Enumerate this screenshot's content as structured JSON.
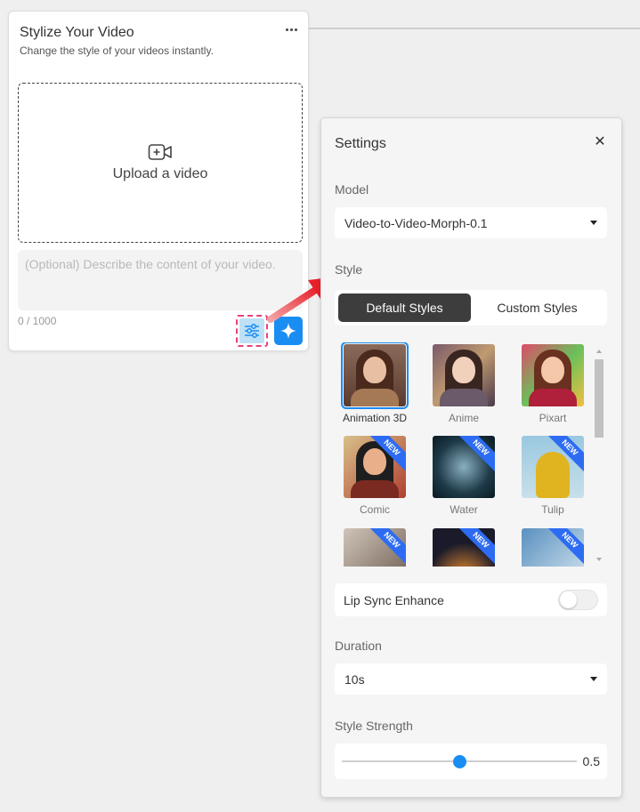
{
  "card": {
    "title": "Stylize Your Video",
    "subtitle": "Change the style of your videos instantly.",
    "upload_label": "Upload a video",
    "description_placeholder": "(Optional) Describe the content of your video.",
    "counter": "0 / 1000"
  },
  "settings": {
    "title": "Settings",
    "model_label": "Model",
    "model_value": "Video-to-Video-Morph-0.1",
    "style_label": "Style",
    "tabs": [
      "Default Styles",
      "Custom Styles"
    ],
    "active_tab": "Default Styles",
    "styles": [
      {
        "name": "Animation 3D",
        "is_new": false,
        "selected": true
      },
      {
        "name": "Anime",
        "is_new": false,
        "selected": false
      },
      {
        "name": "Pixart",
        "is_new": false,
        "selected": false
      },
      {
        "name": "Comic",
        "is_new": true,
        "selected": false
      },
      {
        "name": "Water",
        "is_new": true,
        "selected": false
      },
      {
        "name": "Tulip",
        "is_new": true,
        "selected": false
      },
      {
        "name": "",
        "is_new": true,
        "selected": false
      },
      {
        "name": "",
        "is_new": true,
        "selected": false
      },
      {
        "name": "",
        "is_new": true,
        "selected": false
      }
    ],
    "new_badge": "NEW",
    "lip_sync_label": "Lip Sync Enhance",
    "lip_sync_enabled": false,
    "duration_label": "Duration",
    "duration_value": "10s",
    "strength_label": "Style Strength",
    "strength_value": "0.5"
  },
  "colors": {
    "accent": "#1a8df2",
    "highlight_border": "#e8417c",
    "arrow": "#e8202a"
  }
}
